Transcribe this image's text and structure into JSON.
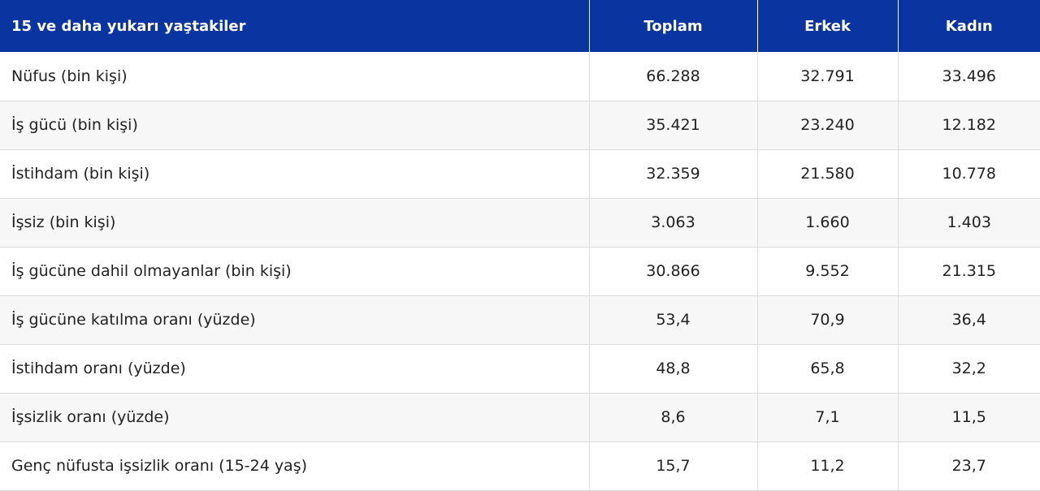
{
  "chart_data": {
    "type": "table",
    "columns": [
      "15 ve daha yukarı yaştakiler",
      "Toplam",
      "Erkek",
      "Kadın"
    ],
    "rows": [
      [
        "Nüfus (bin kişi)",
        "66.288",
        "32.791",
        "33.496"
      ],
      [
        "İş gücü (bin kişi)",
        "35.421",
        "23.240",
        "12.182"
      ],
      [
        "İstihdam (bin kişi)",
        "32.359",
        "21.580",
        "10.778"
      ],
      [
        "İşsiz (bin kişi)",
        "3.063",
        "1.660",
        "1.403"
      ],
      [
        "İş gücüne dahil olmayanlar (bin kişi)",
        "30.866",
        "9.552",
        "21.315"
      ],
      [
        "İş gücüne katılma oranı (yüzde)",
        "53,4",
        "70,9",
        "36,4"
      ],
      [
        "İstihdam oranı (yüzde)",
        "48,8",
        "65,8",
        "32,2"
      ],
      [
        "İşsizlik oranı (yüzde)",
        "8,6",
        "7,1",
        "11,5"
      ],
      [
        "Genç nüfusta işsizlik oranı (15-24 yaş)",
        "15,7",
        "11,2",
        "23,7"
      ]
    ],
    "header_color": "#0a34a0",
    "stripe_color": "#f7f7f7"
  }
}
